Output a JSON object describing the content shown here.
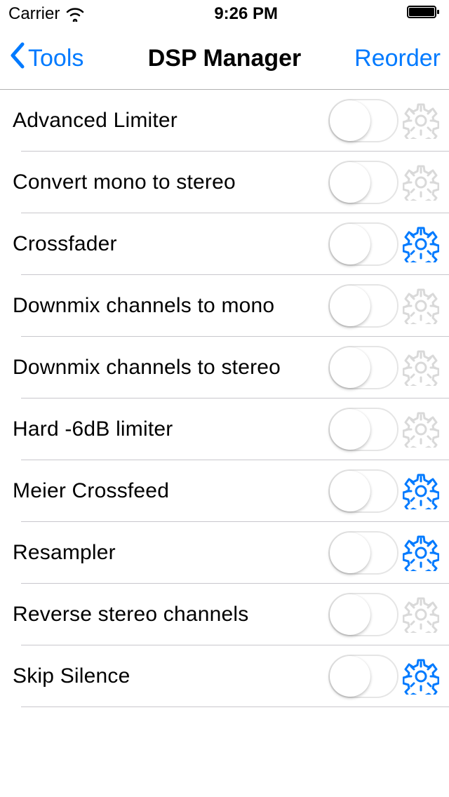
{
  "status": {
    "carrier": "Carrier",
    "time": "9:26 PM"
  },
  "nav": {
    "back": "Tools",
    "title": "DSP Manager",
    "action": "Reorder"
  },
  "rows": [
    {
      "label": "Advanced Limiter",
      "gear_active": false
    },
    {
      "label": "Convert mono to stereo",
      "gear_active": false
    },
    {
      "label": "Crossfader",
      "gear_active": true
    },
    {
      "label": "Downmix channels to mono",
      "gear_active": false
    },
    {
      "label": "Downmix channels to stereo",
      "gear_active": false
    },
    {
      "label": "Hard -6dB limiter",
      "gear_active": false
    },
    {
      "label": "Meier Crossfeed",
      "gear_active": true
    },
    {
      "label": "Resampler",
      "gear_active": true
    },
    {
      "label": "Reverse stereo channels",
      "gear_active": false
    },
    {
      "label": "Skip Silence",
      "gear_active": true
    }
  ]
}
